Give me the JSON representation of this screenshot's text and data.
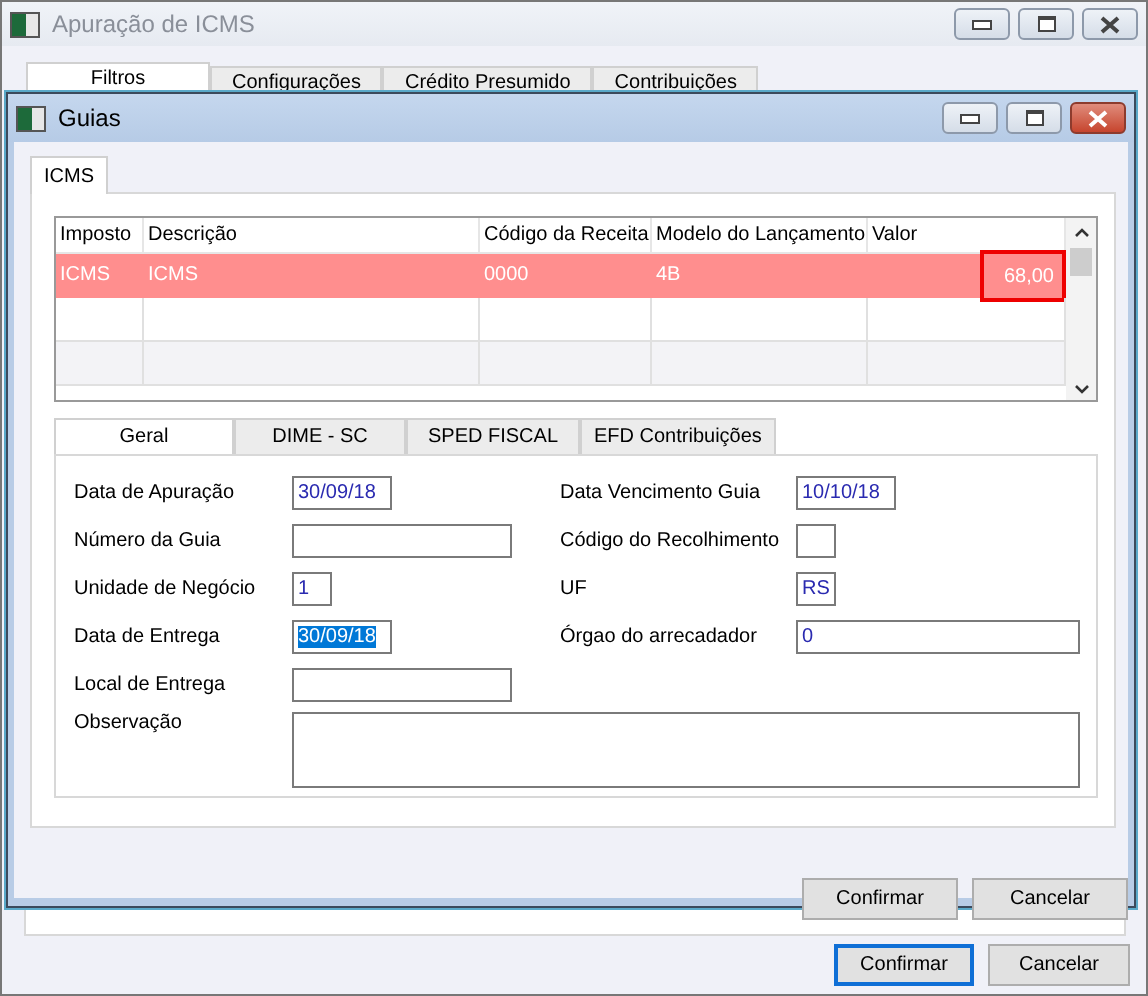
{
  "window": {
    "title": "Apuração de ICMS",
    "tabs": [
      {
        "label": "Filtros",
        "selected": true
      },
      {
        "label": "Configurações",
        "selected": false
      },
      {
        "label": "Crédito Presumido",
        "selected": false
      },
      {
        "label": "Contribuições",
        "selected": false
      }
    ],
    "buttons": [
      {
        "label": "Confirmar",
        "focused": true
      },
      {
        "label": "Cancelar",
        "focused": false
      }
    ]
  },
  "dialog": {
    "title": "Guias",
    "tabs": [
      {
        "label": "ICMS",
        "selected": true
      }
    ],
    "table": {
      "columns": [
        "Imposto",
        "Descrição",
        "Código da Receita",
        "Modelo do Lançamento",
        "Valor"
      ],
      "rows": [
        {
          "cells": [
            "ICMS",
            "ICMS",
            "0000",
            "4B",
            "68,00"
          ],
          "selected": true,
          "value_marked": true
        }
      ]
    },
    "detail_tabs": [
      {
        "label": "Geral",
        "selected": true
      },
      {
        "label": "DIME - SC",
        "selected": false
      },
      {
        "label": "SPED FISCAL",
        "selected": false
      },
      {
        "label": "EFD Contribuições",
        "selected": false
      }
    ],
    "fields_left": [
      {
        "label": "Data de Apuração",
        "value": "30/09/18",
        "kind": "date",
        "selected": false
      },
      {
        "label": "Número da Guia",
        "kind": "medium"
      },
      {
        "label": "Unidade de Negócio",
        "value": "1",
        "kind": "tiny",
        "selected": false
      },
      {
        "label": "Data de Entrega",
        "value": "30/09/18",
        "kind": "date",
        "selected": true
      },
      {
        "label": "Local de Entrega",
        "kind": "medium"
      }
    ],
    "fields_right": [
      {
        "label": "Data Vencimento Guia",
        "value": "10/10/18",
        "kind": "date",
        "selected": false
      },
      {
        "label": "Código do Recolhimento",
        "kind": "tiny"
      },
      {
        "label": "UF",
        "value": "RS",
        "kind": "tiny",
        "selected": false
      },
      {
        "label": "Órgao do arrecadador",
        "value": "0",
        "kind": "long",
        "selected": false
      }
    ],
    "notes": {
      "label": "Observação"
    },
    "buttons": [
      {
        "label": "Confirmar",
        "focused": false
      },
      {
        "label": "Cancelar",
        "focused": false
      }
    ]
  }
}
